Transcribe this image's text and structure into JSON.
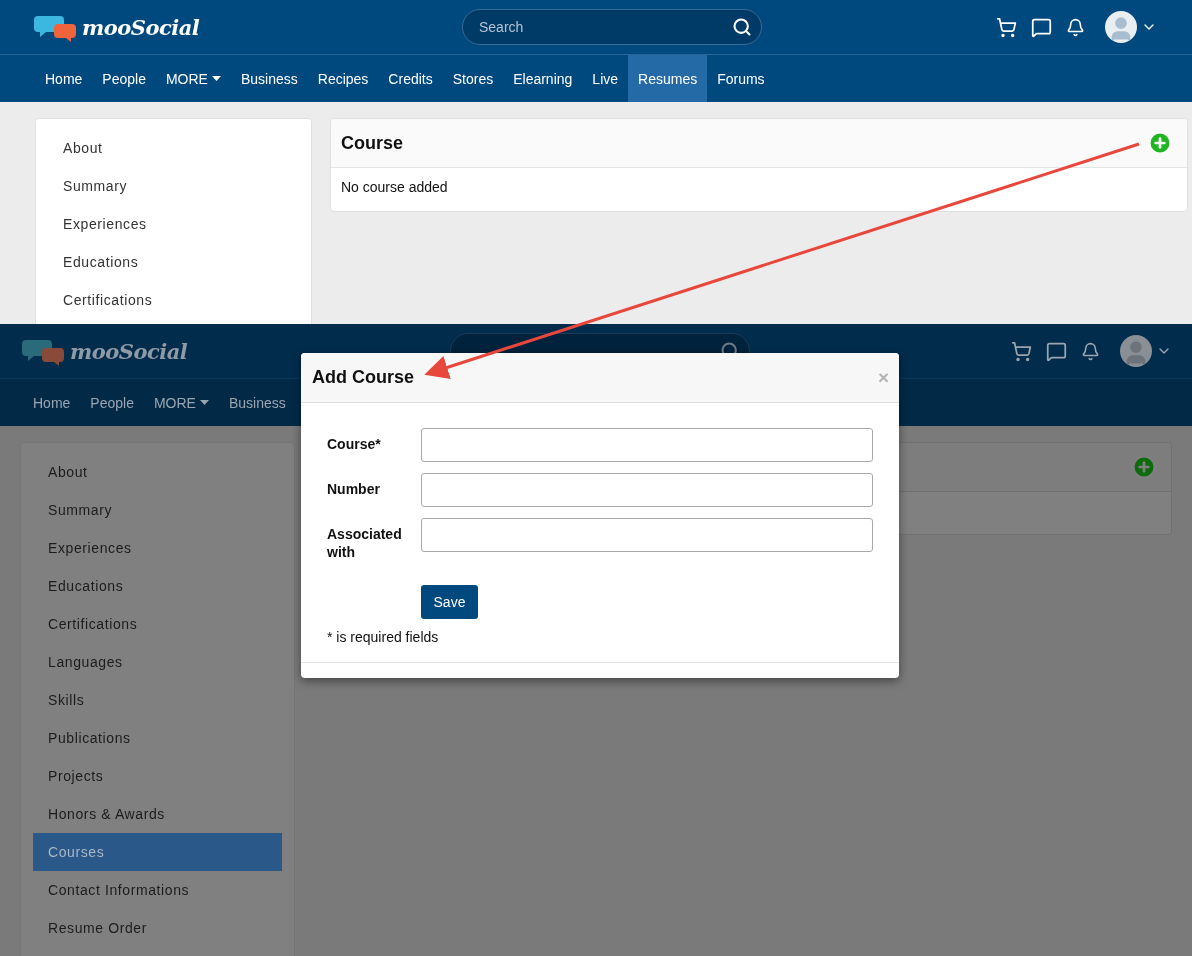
{
  "top_screen": {
    "brand": "mooSocial",
    "search": {
      "placeholder": "Search"
    },
    "nav": [
      {
        "label": "Home",
        "kind": "link",
        "selected": false
      },
      {
        "label": "People",
        "kind": "link",
        "selected": false
      },
      {
        "label": "MORE",
        "kind": "dropdown",
        "selected": false
      },
      {
        "label": "Business",
        "kind": "link",
        "selected": false
      },
      {
        "label": "Recipes",
        "kind": "link",
        "selected": false
      },
      {
        "label": "Credits",
        "kind": "link",
        "selected": false
      },
      {
        "label": "Stores",
        "kind": "link",
        "selected": false
      },
      {
        "label": "Elearning",
        "kind": "link",
        "selected": false
      },
      {
        "label": "Live",
        "kind": "link",
        "selected": false
      },
      {
        "label": "Resumes",
        "kind": "link",
        "selected": true
      },
      {
        "label": "Forums",
        "kind": "link",
        "selected": false
      }
    ],
    "sidebar": [
      {
        "label": "About",
        "selected": false
      },
      {
        "label": "Summary",
        "selected": false
      },
      {
        "label": "Experiences",
        "selected": false
      },
      {
        "label": "Educations",
        "selected": false
      },
      {
        "label": "Certifications",
        "selected": false
      }
    ],
    "card": {
      "title": "Course",
      "empty_text": "No course added"
    }
  },
  "bottom_screen": {
    "brand": "mooSocial",
    "nav": [
      {
        "label": "Home",
        "kind": "link",
        "selected": false
      },
      {
        "label": "People",
        "kind": "link",
        "selected": false
      },
      {
        "label": "MORE",
        "kind": "dropdown",
        "selected": false
      },
      {
        "label": "Business",
        "kind": "link",
        "selected": false
      }
    ],
    "sidebar": [
      {
        "label": "About",
        "selected": false
      },
      {
        "label": "Summary",
        "selected": false
      },
      {
        "label": "Experiences",
        "selected": false
      },
      {
        "label": "Educations",
        "selected": false
      },
      {
        "label": "Certifications",
        "selected": false
      },
      {
        "label": "Languages",
        "selected": false
      },
      {
        "label": "Skills",
        "selected": false
      },
      {
        "label": "Publications",
        "selected": false
      },
      {
        "label": "Projects",
        "selected": false
      },
      {
        "label": "Honors & Awards",
        "selected": false
      },
      {
        "label": "Courses",
        "selected": true
      },
      {
        "label": "Contact Informations",
        "selected": false
      },
      {
        "label": "Resume Order",
        "selected": false
      }
    ],
    "modal": {
      "title": "Add Course",
      "close": "×",
      "fields": [
        {
          "label": "Course*"
        },
        {
          "label": "Number"
        },
        {
          "label": "Associated with"
        }
      ],
      "save": "Save",
      "note": "* is required fields"
    }
  }
}
